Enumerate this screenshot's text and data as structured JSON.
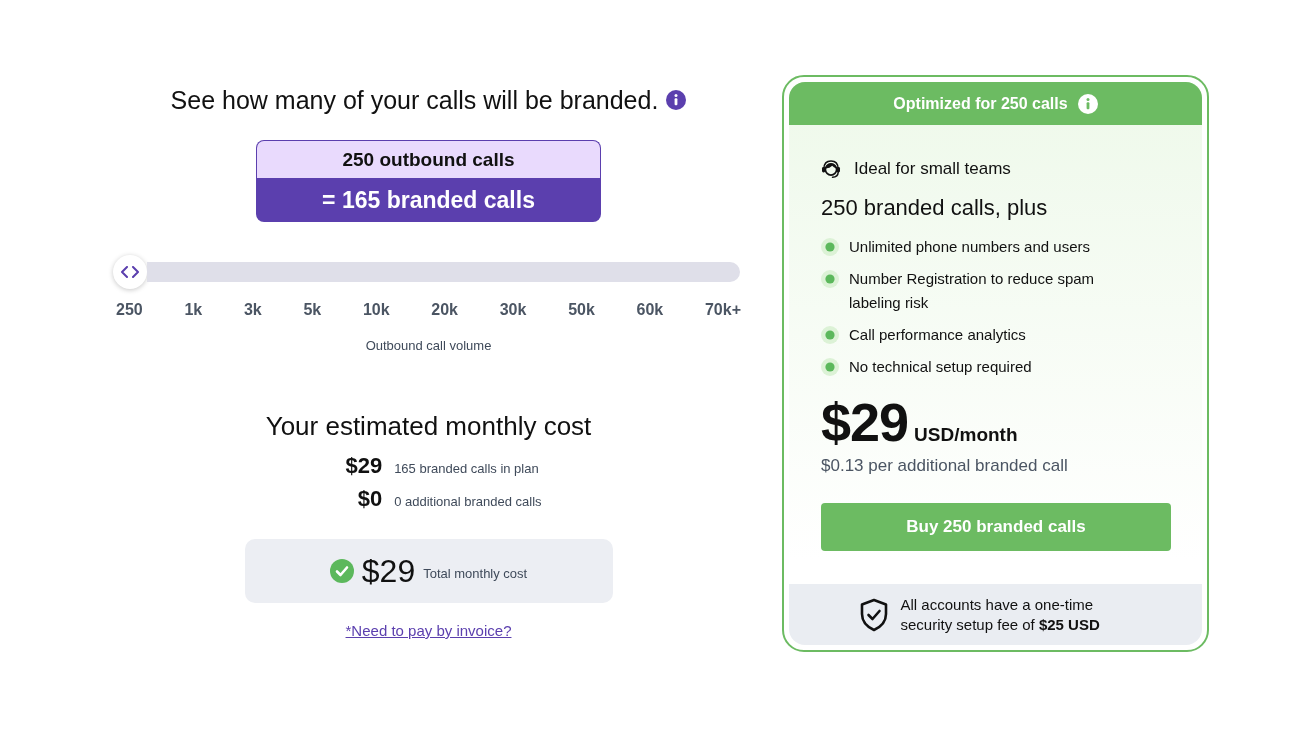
{
  "calculator": {
    "title": "See how many of your calls will be branded.",
    "summary": {
      "outbound": "250 outbound calls",
      "branded": "= 165 branded calls"
    },
    "slider": {
      "level": 0,
      "ticks": [
        "250",
        "1k",
        "3k",
        "5k",
        "10k",
        "20k",
        "30k",
        "50k",
        "60k",
        "70k+"
      ],
      "caption": "Outbound call volume"
    },
    "cost": {
      "title": "Your estimated monthly cost",
      "lines": [
        {
          "amount": "$29",
          "label": "165 branded calls in plan"
        },
        {
          "amount": "$0",
          "label": "0 additional branded calls"
        }
      ],
      "total": {
        "amount": "$29",
        "label": "Total monthly cost"
      }
    },
    "invoice_link": "*Need to pay by invoice?"
  },
  "plan_card": {
    "badge": "Optimized for 250 calls",
    "audience": "Ideal for small teams",
    "headline": "250 branded calls, plus",
    "features": [
      "Unlimited phone numbers and users",
      "Number Registration to reduce spam labeling risk",
      "Call performance analytics",
      "No technical setup required"
    ],
    "price": "$29",
    "period": "USD/month",
    "overage": "$0.13 per additional branded call",
    "button": "Buy 250 branded calls",
    "note": "All accounts have a one-time security setup fee of **$25 USD**"
  }
}
